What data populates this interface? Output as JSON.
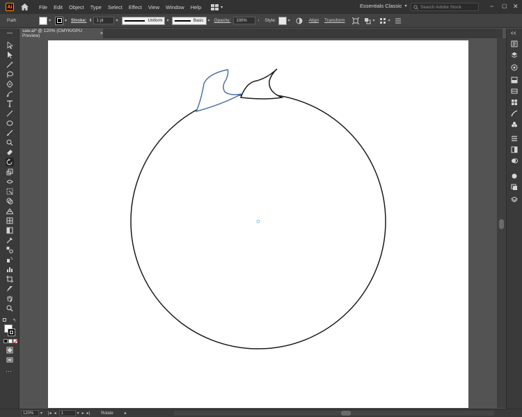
{
  "app": {
    "logo_text": "Ai"
  },
  "menu": {
    "items": [
      "File",
      "Edit",
      "Object",
      "Type",
      "Select",
      "Effect",
      "View",
      "Window",
      "Help"
    ]
  },
  "workspace": {
    "label": "Essentials Classic"
  },
  "search": {
    "placeholder": "Search Adobe Stock"
  },
  "control_bar": {
    "selection_label": "Path",
    "stroke_label": "Stroke:",
    "stroke_weight": "1 pt",
    "variable_width_label": "Uniform",
    "brush_label": "Basic",
    "opacity_label": "Opacity:",
    "opacity_value": "100%",
    "style_label": "Style:",
    "align_label": "Align",
    "transform_label": "Transform"
  },
  "document_tab": {
    "title": "saw.ai* @ 120% (CMYK/GPU Preview)",
    "close_glyph": "×"
  },
  "status_bar": {
    "zoom": "120%",
    "artboard_number": "1",
    "current_tool": "Rotate"
  },
  "colors": {
    "selection_blue": "#4a6fa5",
    "ui_dark": "#323232",
    "ui_panel": "#3a3a3a",
    "canvas_bg": "#535353",
    "logo_orange": "#ff9a00"
  }
}
